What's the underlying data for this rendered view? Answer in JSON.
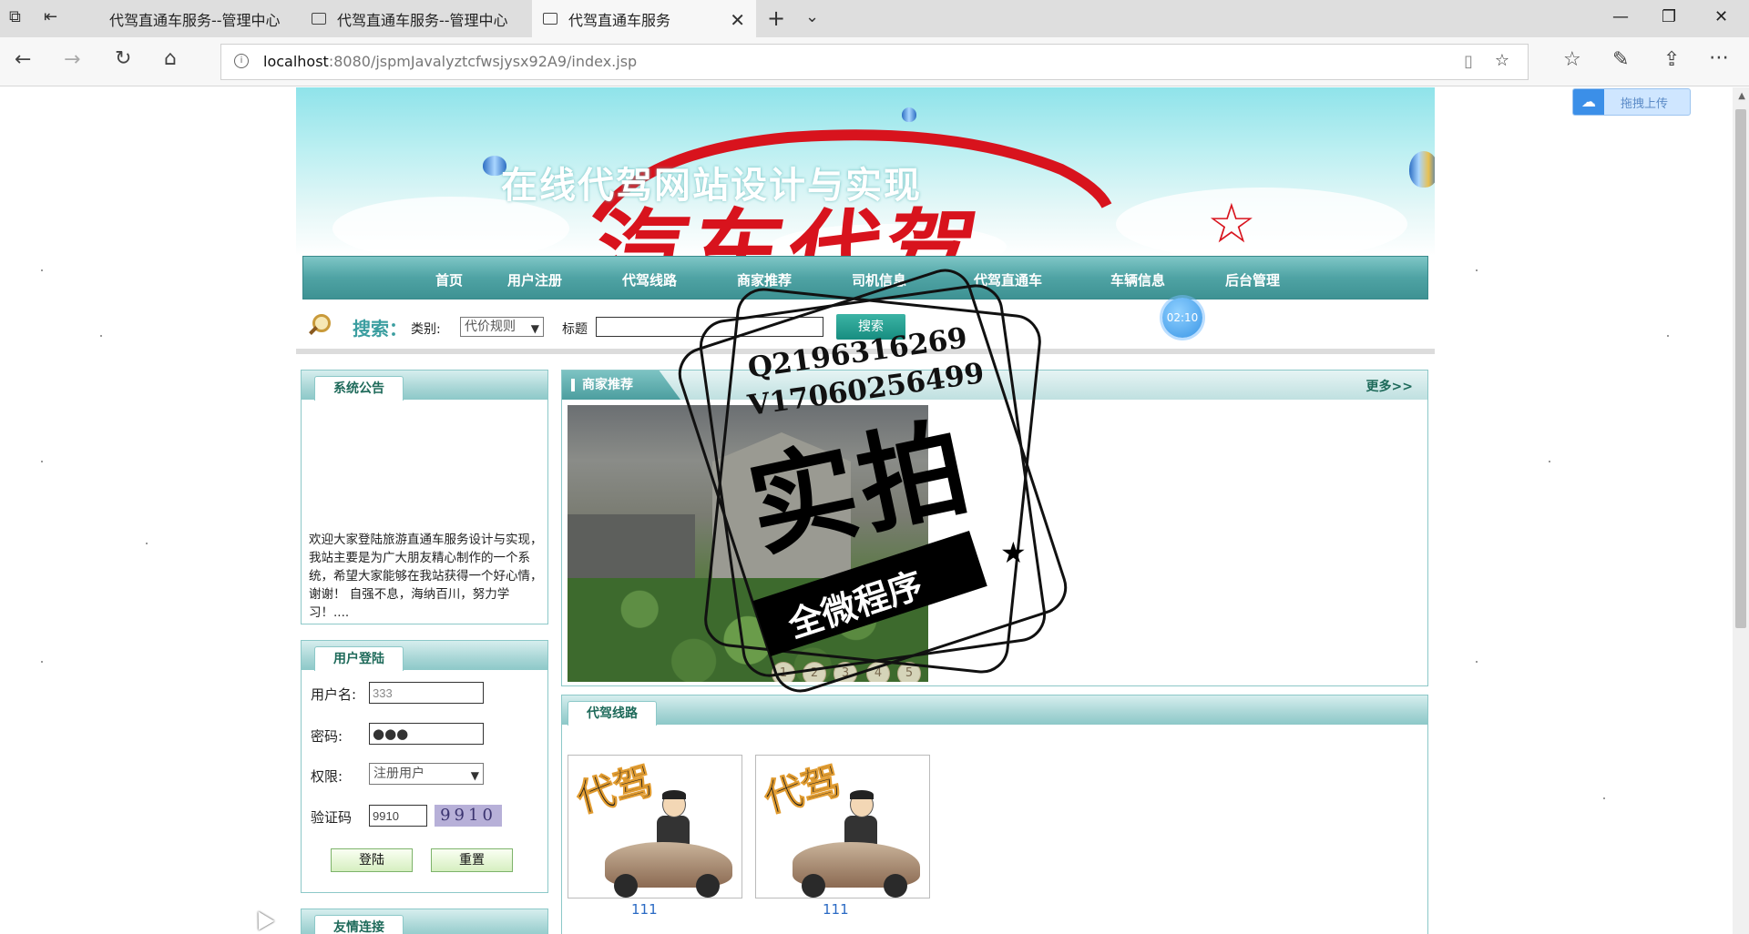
{
  "browser": {
    "tabs": [
      {
        "title": "代驾直通车服务--管理中心",
        "active": false
      },
      {
        "title": "代驾直通车服务--管理中心",
        "active": false
      },
      {
        "title": "代驾直通车服务",
        "active": true
      }
    ],
    "url_host": "localhost",
    "url_rest": ":8080/jspmJavalyztcfwsjysx92A9/index.jsp"
  },
  "banner": {
    "title": "在线代驾网站设计与实现",
    "logo_text": "汽车代驾"
  },
  "nav": {
    "items": [
      "首页",
      "用户注册",
      "代驾线路",
      "商家推荐",
      "司机信息",
      "代驾直通车",
      "车辆信息",
      "后台管理"
    ]
  },
  "search": {
    "label": "搜索：",
    "category_label": "类别:",
    "category_value": "代价规则",
    "title_label": "标题",
    "title_value": "",
    "button_label": "搜索"
  },
  "notice": {
    "title": "系统公告",
    "text": "欢迎大家登陆旅游直通车服务设计与实现，我站主要是为广大朋友精心制作的一个系统，希望大家能够在我站获得一个好心情，谢谢！ 自强不息，海纳百川，努力学习！...."
  },
  "login": {
    "title": "用户登陆",
    "username_label": "用户名:",
    "username_value": "333",
    "password_label": "密码:",
    "password_value": "●●●",
    "role_label": "权限:",
    "role_value": "注册用户",
    "captcha_label": "验证码",
    "captcha_value": "9910",
    "captcha_image_text": "9910",
    "login_button": "登陆",
    "reset_button": "重置"
  },
  "links": {
    "title": "友情连接"
  },
  "merchant": {
    "title": "商家推荐",
    "more": "更多>>",
    "slide_dots": [
      "1",
      "2",
      "3",
      "4",
      "5"
    ]
  },
  "routes": {
    "title": "代驾线路",
    "items": [
      {
        "label": "111",
        "image_text": "代驾"
      },
      {
        "label": "111",
        "image_text": "代驾"
      }
    ]
  },
  "overlay": {
    "timer": "02:10",
    "upload": "拖拽上传",
    "watermark_line1": "Q2196316269",
    "watermark_line2": "V17060256499",
    "watermark_big": "实拍",
    "watermark_ribbon": "全微程序"
  }
}
